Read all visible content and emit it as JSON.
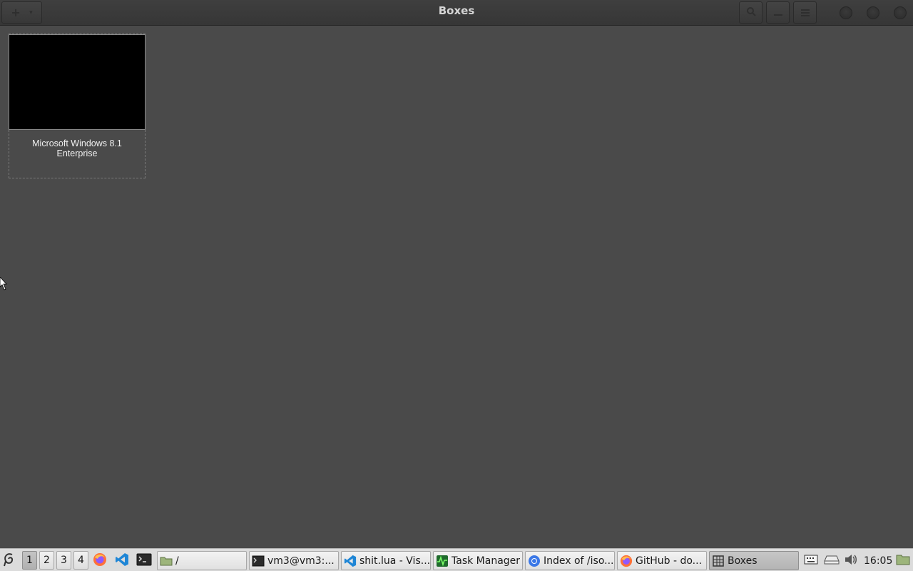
{
  "window": {
    "title": "Boxes",
    "new_button_glyph": "+",
    "new_button_chevron": "▾"
  },
  "boxes": [
    {
      "name": "Microsoft Windows 8.1\nEnterprise"
    }
  ],
  "taskbar": {
    "workspaces": [
      "1",
      "2",
      "3",
      "4"
    ],
    "active_workspace": "1",
    "tasks": [
      {
        "label": "/",
        "icon": "folder-icon"
      },
      {
        "label": "vm3@vm3:...",
        "icon": "terminal-icon"
      },
      {
        "label": "shit.lua - Vis...",
        "icon": "vscode-icon"
      },
      {
        "label": "Task Manager",
        "icon": "task-manager-icon"
      },
      {
        "label": "Index of /iso...",
        "icon": "chromium-icon"
      },
      {
        "label": "GitHub - do...",
        "icon": "firefox-icon"
      },
      {
        "label": "Boxes",
        "icon": "boxes-icon"
      }
    ],
    "clock": "16:05"
  },
  "colors": {
    "window_bg": "#4a4a4a",
    "headerbar_bg": "#3a3a3a",
    "taskbar_bg": "#dcdcdc",
    "thumbnail_bg": "#000000"
  }
}
